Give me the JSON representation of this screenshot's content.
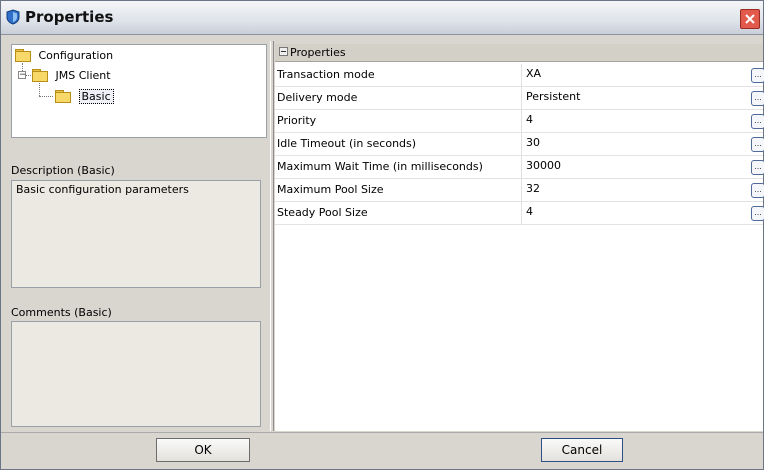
{
  "window": {
    "title": "Properties"
  },
  "tree": {
    "root": "Configuration",
    "child": "JMS Client",
    "grandchild": "Basic"
  },
  "description": {
    "label": "Description (Basic)",
    "text": "Basic configuration parameters"
  },
  "comments": {
    "label": "Comments (Basic)",
    "text": ""
  },
  "sheet": {
    "header": "Properties",
    "rows": [
      {
        "name": "Transaction mode",
        "value": "XA"
      },
      {
        "name": "Delivery mode",
        "value": "Persistent"
      },
      {
        "name": "Priority",
        "value": "4"
      },
      {
        "name": "Idle Timeout (in seconds)",
        "value": "30"
      },
      {
        "name": "Maximum Wait Time (in milliseconds)",
        "value": "30000"
      },
      {
        "name": "Maximum Pool Size",
        "value": "32"
      },
      {
        "name": "Steady Pool Size",
        "value": "4"
      }
    ],
    "ellipsis": "..."
  },
  "buttons": {
    "ok": "OK",
    "cancel": "Cancel"
  }
}
